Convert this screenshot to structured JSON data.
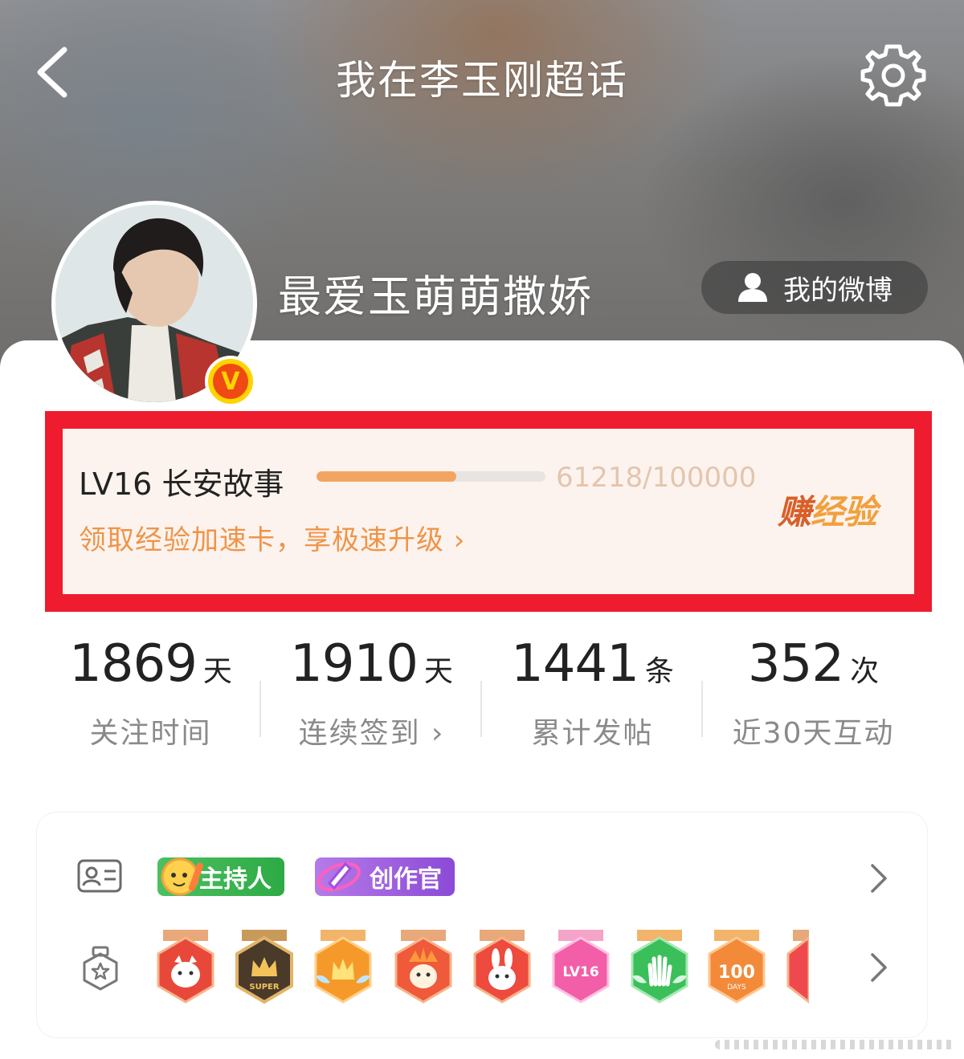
{
  "header": {
    "title": "我在李玉刚超话"
  },
  "profile": {
    "username": "最爱玉萌萌撒娇",
    "verify_badge": "V",
    "my_weibo_label": "我的微博"
  },
  "level": {
    "label": "LV16 长安故事",
    "progress_text": "61218/100000",
    "progress_fraction": 0.61218,
    "speed_link": "领取经验加速卡，享极速升级 ›",
    "earn_part1": "赚",
    "earn_part2": "经验",
    "accent_color": "#f2a560",
    "highlight_color": "#ee1c2e"
  },
  "stats": [
    {
      "value": "1869",
      "unit": "天",
      "label": "关注时间"
    },
    {
      "value": "1910",
      "unit": "天",
      "label": "连续签到 ›"
    },
    {
      "value": "1441",
      "unit": "条",
      "label": "累计发帖"
    },
    {
      "value": "352",
      "unit": "次",
      "label": "近30天互动"
    }
  ],
  "identity_tags": [
    {
      "label": "主持人",
      "color": "#2daa45"
    },
    {
      "label": "创作官",
      "color": "#8c4ad6"
    }
  ],
  "medals": [
    {
      "icon": "cat-medal-icon",
      "text": ""
    },
    {
      "icon": "super-crown-medal-icon",
      "text": "SUPER"
    },
    {
      "icon": "crown-wings-medal-icon",
      "text": ""
    },
    {
      "icon": "dragon-medal-icon",
      "text": ""
    },
    {
      "icon": "rabbit-medal-icon",
      "text": ""
    },
    {
      "icon": "lv16-medal-icon",
      "text": "LV16"
    },
    {
      "icon": "hand-medal-icon",
      "text": ""
    },
    {
      "icon": "100-days-medal-icon",
      "text": "100"
    },
    {
      "icon": "partial-medal-icon",
      "text": ""
    }
  ],
  "medal_sublabels": {
    "days": "DAYS"
  }
}
